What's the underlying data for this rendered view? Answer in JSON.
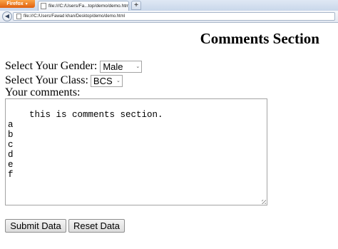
{
  "browser": {
    "menu_label": "Firefox",
    "tab_title": "file:///C:/Users/Fa...top/demo/demo.html",
    "new_tab_symbol": "+",
    "url": "file:///C:/Users/Fawad khan/Desktop/demo/demo.html",
    "accent_color": "#e66000"
  },
  "page": {
    "title": "Comments Section",
    "gender": {
      "label": "Select Your Gender:",
      "value": "Male"
    },
    "class": {
      "label": "Select Your Class:",
      "value": "BCS"
    },
    "comments": {
      "label": "Your comments:",
      "value": "this is comments section.\na\nb\nc\nd\ne\nf"
    },
    "buttons": {
      "submit": "Submit Data",
      "reset": "Reset Data"
    }
  }
}
